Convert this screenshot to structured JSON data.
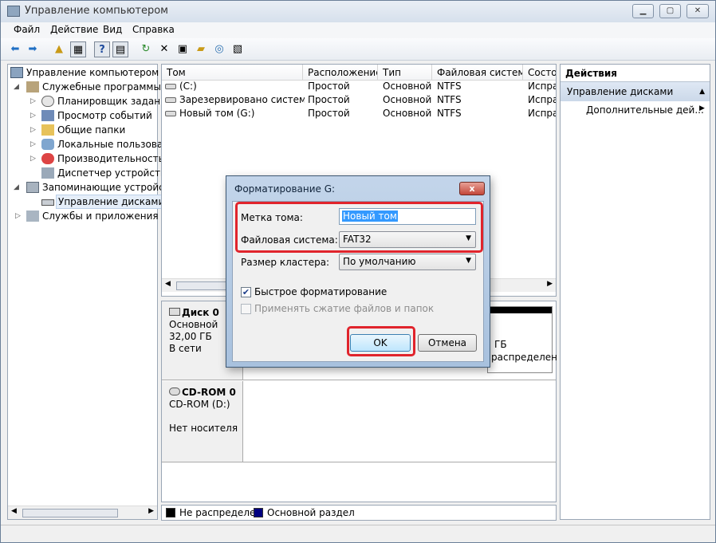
{
  "window": {
    "title": "Управление компьютером"
  },
  "menu": [
    "Файл",
    "Действие",
    "Вид",
    "Справка"
  ],
  "toolbar": {
    "icons": [
      "back-icon",
      "forward-icon",
      "up-folder-icon",
      "show-hide-tree-icon",
      "help-icon",
      "console-icon",
      "refresh-icon",
      "delete-icon",
      "properties-icon",
      "open-icon",
      "search-icon",
      "help-topic-icon"
    ]
  },
  "tree": {
    "root": "Управление компьютером (л",
    "system_tools": "Служебные программы",
    "task_scheduler": "Планировщик заданий",
    "event_viewer": "Просмотр событий",
    "shared_folders": "Общие папки",
    "local_users": "Локальные пользовате",
    "performance": "Производительность",
    "device_manager": "Диспетчер устройств",
    "storage": "Запоминающие устройст",
    "disk_management": "Управление дисками",
    "services_apps": "Службы и приложения"
  },
  "volumes": {
    "columns": [
      "Том",
      "Расположение",
      "Тип",
      "Файловая система",
      "Состо"
    ],
    "rows": [
      {
        "name": "(C:)",
        "layout": "Простой",
        "type": "Основной",
        "fs": "NTFS",
        "status": "Испра"
      },
      {
        "name": "Зарезервировано системой",
        "layout": "Простой",
        "type": "Основной",
        "fs": "NTFS",
        "status": "Испра"
      },
      {
        "name": "Новый том (G:)",
        "layout": "Простой",
        "type": "Основной",
        "fs": "NTFS",
        "status": "Испра"
      }
    ]
  },
  "disks": {
    "disk0": {
      "name": "Диск 0",
      "type": "Основной",
      "size": "32,00 ГБ",
      "status": "В сети",
      "partial_size": "ГБ",
      "partial_status": "распределен"
    },
    "cdrom0": {
      "name": "CD-ROM 0",
      "drive": "CD-ROM (D:)",
      "status": "Нет носителя"
    }
  },
  "legend": {
    "unallocated": "Не распределен",
    "primary": "Основной раздел",
    "unallocated_color": "#000000",
    "primary_color": "#000080"
  },
  "actions": {
    "header": "Действия",
    "section": "Управление дисками",
    "more": "Дополнительные дей..."
  },
  "dialog": {
    "title": "Форматирование G:",
    "close_label": "x",
    "volume_label_label": "Метка тома:",
    "volume_label_value": "Новый том",
    "filesystem_label": "Файловая система:",
    "filesystem_value": "FAT32",
    "cluster_label": "Размер кластера:",
    "cluster_value": "По умолчанию",
    "quick_format_label": "Быстрое форматирование",
    "quick_format_checked": true,
    "compression_label": "Применять сжатие файлов и папок",
    "compression_checked": false,
    "ok_label": "OK",
    "cancel_label": "Отмена"
  },
  "colors": {
    "highlight": "#e0242c",
    "selection": "#3399ff"
  }
}
